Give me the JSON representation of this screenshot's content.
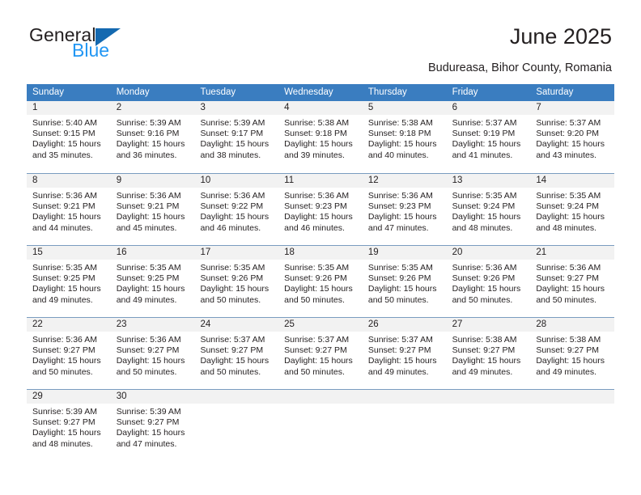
{
  "branding": {
    "logo_primary": "General",
    "logo_secondary": "Blue",
    "logo_shape": "triangle-icon"
  },
  "header": {
    "title": "June 2025",
    "subtitle": "Budureasa, Bihor County, Romania"
  },
  "colors": {
    "header_blue": "#3a7dc0",
    "logo_blue": "#2196f3",
    "logo_triangle": "#1469b0",
    "day_band": "#f2f2f2",
    "row_divider": "#7a9cc0",
    "text": "#231f20"
  },
  "weekdays": [
    "Sunday",
    "Monday",
    "Tuesday",
    "Wednesday",
    "Thursday",
    "Friday",
    "Saturday"
  ],
  "weeks": [
    [
      {
        "day": "1",
        "sunrise": "Sunrise: 5:40 AM",
        "sunset": "Sunset: 9:15 PM",
        "daylight": "Daylight: 15 hours and 35 minutes."
      },
      {
        "day": "2",
        "sunrise": "Sunrise: 5:39 AM",
        "sunset": "Sunset: 9:16 PM",
        "daylight": "Daylight: 15 hours and 36 minutes."
      },
      {
        "day": "3",
        "sunrise": "Sunrise: 5:39 AM",
        "sunset": "Sunset: 9:17 PM",
        "daylight": "Daylight: 15 hours and 38 minutes."
      },
      {
        "day": "4",
        "sunrise": "Sunrise: 5:38 AM",
        "sunset": "Sunset: 9:18 PM",
        "daylight": "Daylight: 15 hours and 39 minutes."
      },
      {
        "day": "5",
        "sunrise": "Sunrise: 5:38 AM",
        "sunset": "Sunset: 9:18 PM",
        "daylight": "Daylight: 15 hours and 40 minutes."
      },
      {
        "day": "6",
        "sunrise": "Sunrise: 5:37 AM",
        "sunset": "Sunset: 9:19 PM",
        "daylight": "Daylight: 15 hours and 41 minutes."
      },
      {
        "day": "7",
        "sunrise": "Sunrise: 5:37 AM",
        "sunset": "Sunset: 9:20 PM",
        "daylight": "Daylight: 15 hours and 43 minutes."
      }
    ],
    [
      {
        "day": "8",
        "sunrise": "Sunrise: 5:36 AM",
        "sunset": "Sunset: 9:21 PM",
        "daylight": "Daylight: 15 hours and 44 minutes."
      },
      {
        "day": "9",
        "sunrise": "Sunrise: 5:36 AM",
        "sunset": "Sunset: 9:21 PM",
        "daylight": "Daylight: 15 hours and 45 minutes."
      },
      {
        "day": "10",
        "sunrise": "Sunrise: 5:36 AM",
        "sunset": "Sunset: 9:22 PM",
        "daylight": "Daylight: 15 hours and 46 minutes."
      },
      {
        "day": "11",
        "sunrise": "Sunrise: 5:36 AM",
        "sunset": "Sunset: 9:23 PM",
        "daylight": "Daylight: 15 hours and 46 minutes."
      },
      {
        "day": "12",
        "sunrise": "Sunrise: 5:36 AM",
        "sunset": "Sunset: 9:23 PM",
        "daylight": "Daylight: 15 hours and 47 minutes."
      },
      {
        "day": "13",
        "sunrise": "Sunrise: 5:35 AM",
        "sunset": "Sunset: 9:24 PM",
        "daylight": "Daylight: 15 hours and 48 minutes."
      },
      {
        "day": "14",
        "sunrise": "Sunrise: 5:35 AM",
        "sunset": "Sunset: 9:24 PM",
        "daylight": "Daylight: 15 hours and 48 minutes."
      }
    ],
    [
      {
        "day": "15",
        "sunrise": "Sunrise: 5:35 AM",
        "sunset": "Sunset: 9:25 PM",
        "daylight": "Daylight: 15 hours and 49 minutes."
      },
      {
        "day": "16",
        "sunrise": "Sunrise: 5:35 AM",
        "sunset": "Sunset: 9:25 PM",
        "daylight": "Daylight: 15 hours and 49 minutes."
      },
      {
        "day": "17",
        "sunrise": "Sunrise: 5:35 AM",
        "sunset": "Sunset: 9:26 PM",
        "daylight": "Daylight: 15 hours and 50 minutes."
      },
      {
        "day": "18",
        "sunrise": "Sunrise: 5:35 AM",
        "sunset": "Sunset: 9:26 PM",
        "daylight": "Daylight: 15 hours and 50 minutes."
      },
      {
        "day": "19",
        "sunrise": "Sunrise: 5:35 AM",
        "sunset": "Sunset: 9:26 PM",
        "daylight": "Daylight: 15 hours and 50 minutes."
      },
      {
        "day": "20",
        "sunrise": "Sunrise: 5:36 AM",
        "sunset": "Sunset: 9:26 PM",
        "daylight": "Daylight: 15 hours and 50 minutes."
      },
      {
        "day": "21",
        "sunrise": "Sunrise: 5:36 AM",
        "sunset": "Sunset: 9:27 PM",
        "daylight": "Daylight: 15 hours and 50 minutes."
      }
    ],
    [
      {
        "day": "22",
        "sunrise": "Sunrise: 5:36 AM",
        "sunset": "Sunset: 9:27 PM",
        "daylight": "Daylight: 15 hours and 50 minutes."
      },
      {
        "day": "23",
        "sunrise": "Sunrise: 5:36 AM",
        "sunset": "Sunset: 9:27 PM",
        "daylight": "Daylight: 15 hours and 50 minutes."
      },
      {
        "day": "24",
        "sunrise": "Sunrise: 5:37 AM",
        "sunset": "Sunset: 9:27 PM",
        "daylight": "Daylight: 15 hours and 50 minutes."
      },
      {
        "day": "25",
        "sunrise": "Sunrise: 5:37 AM",
        "sunset": "Sunset: 9:27 PM",
        "daylight": "Daylight: 15 hours and 50 minutes."
      },
      {
        "day": "26",
        "sunrise": "Sunrise: 5:37 AM",
        "sunset": "Sunset: 9:27 PM",
        "daylight": "Daylight: 15 hours and 49 minutes."
      },
      {
        "day": "27",
        "sunrise": "Sunrise: 5:38 AM",
        "sunset": "Sunset: 9:27 PM",
        "daylight": "Daylight: 15 hours and 49 minutes."
      },
      {
        "day": "28",
        "sunrise": "Sunrise: 5:38 AM",
        "sunset": "Sunset: 9:27 PM",
        "daylight": "Daylight: 15 hours and 49 minutes."
      }
    ],
    [
      {
        "day": "29",
        "sunrise": "Sunrise: 5:39 AM",
        "sunset": "Sunset: 9:27 PM",
        "daylight": "Daylight: 15 hours and 48 minutes."
      },
      {
        "day": "30",
        "sunrise": "Sunrise: 5:39 AM",
        "sunset": "Sunset: 9:27 PM",
        "daylight": "Daylight: 15 hours and 47 minutes."
      },
      {
        "day": "",
        "sunrise": "",
        "sunset": "",
        "daylight": ""
      },
      {
        "day": "",
        "sunrise": "",
        "sunset": "",
        "daylight": ""
      },
      {
        "day": "",
        "sunrise": "",
        "sunset": "",
        "daylight": ""
      },
      {
        "day": "",
        "sunrise": "",
        "sunset": "",
        "daylight": ""
      },
      {
        "day": "",
        "sunrise": "",
        "sunset": "",
        "daylight": ""
      }
    ]
  ]
}
